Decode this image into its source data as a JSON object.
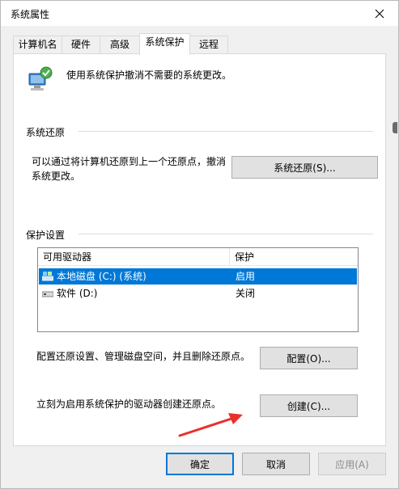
{
  "window": {
    "title": "系统属性"
  },
  "tabs": [
    {
      "label": "计算机名"
    },
    {
      "label": "硬件"
    },
    {
      "label": "高级"
    },
    {
      "label": "系统保护"
    },
    {
      "label": "远程"
    }
  ],
  "header": {
    "description": "使用系统保护撤消不需要的系统更改。"
  },
  "restore": {
    "group_label": "系统还原",
    "text": "可以通过将计算机还原到上一个还原点，撤消系统更改。",
    "button": "系统还原(S)..."
  },
  "protection": {
    "group_label": "保护设置",
    "columns": [
      "可用驱动器",
      "保护"
    ],
    "rows": [
      {
        "drive": "本地磁盘 (C:) (系统)",
        "status": "启用",
        "selected": true
      },
      {
        "drive": "软件 (D:)",
        "status": "关闭",
        "selected": false
      }
    ],
    "configure_text": "配置还原设置、管理磁盘空间，并且删除还原点。",
    "configure_button": "配置(O)...",
    "create_text": "立刻为启用系统保护的驱动器创建还原点。",
    "create_button": "创建(C)..."
  },
  "footer": {
    "ok": "确定",
    "cancel": "取消",
    "apply": "应用(A)"
  },
  "colors": {
    "accent": "#0078d7",
    "annotation": "#e8302c"
  }
}
